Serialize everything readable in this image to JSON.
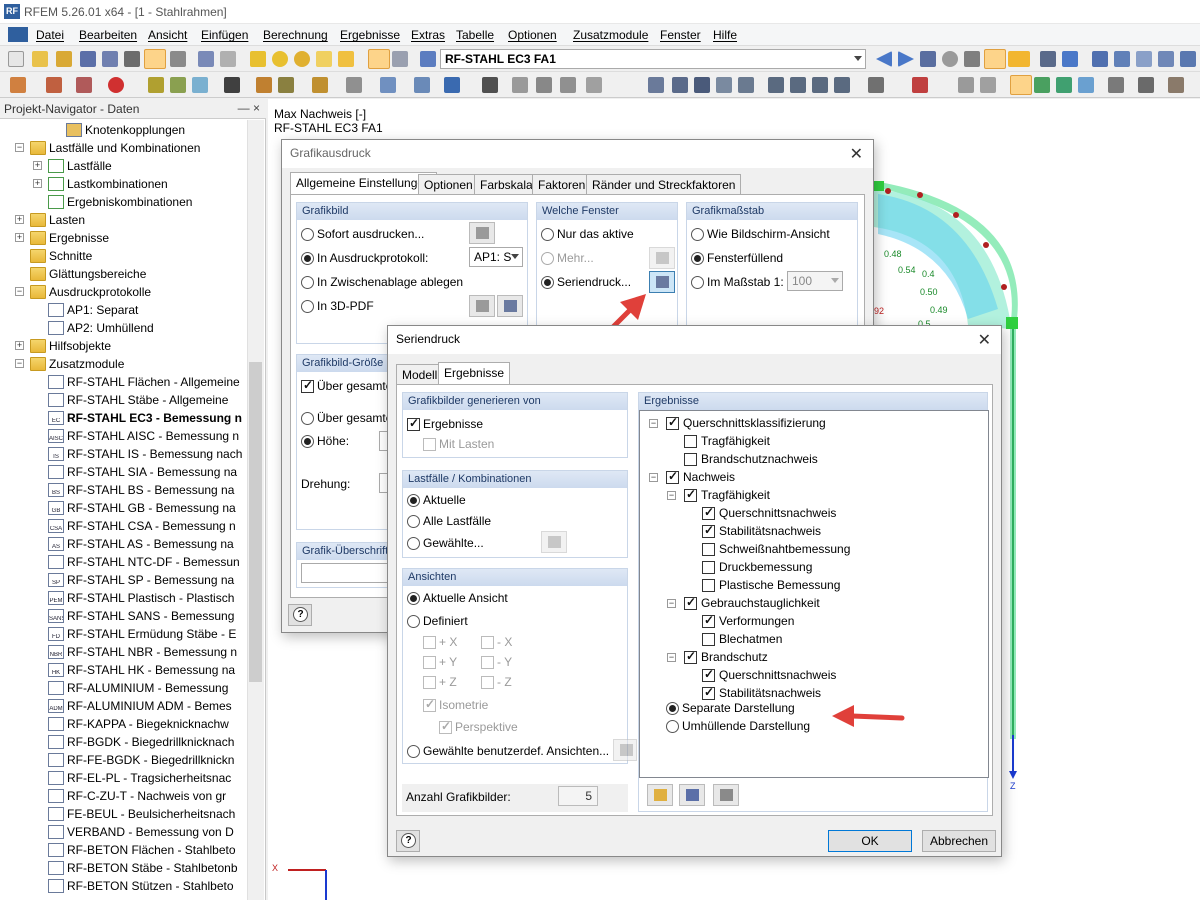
{
  "app": {
    "title": "RFEM 5.26.01 x64 - [1 - Stahlrahmen]",
    "logo": "RF"
  },
  "menu": [
    "Datei",
    "Bearbeiten",
    "Ansicht",
    "Einfügen",
    "Berechnung",
    "Ergebnisse",
    "Extras",
    "Tabelle",
    "Optionen",
    "Zusatzmodule",
    "Fenster",
    "Hilfe"
  ],
  "toolbar": {
    "case_combo": "RF-STAHL EC3 FA1"
  },
  "navigator": {
    "title": "Projekt-Navigator - Daten",
    "pin": "―  ×",
    "items": [
      {
        "label": "Knotenkopplungen"
      },
      {
        "label": "Lastfälle und Kombinationen"
      },
      {
        "label": "Lastfälle"
      },
      {
        "label": "Lastkombinationen"
      },
      {
        "label": "Ergebniskombinationen"
      },
      {
        "label": "Lasten"
      },
      {
        "label": "Ergebnisse"
      },
      {
        "label": "Schnitte"
      },
      {
        "label": "Glättungsbereiche"
      },
      {
        "label": "Ausdruckprotokolle"
      },
      {
        "label": "AP1: Separat"
      },
      {
        "label": "AP2: Umhüllend"
      },
      {
        "label": "Hilfsobjekte"
      },
      {
        "label": "Zusatzmodule"
      },
      {
        "label": "RF-STAHL Flächen - Allgemeine"
      },
      {
        "label": "RF-STAHL Stäbe - Allgemeine"
      },
      {
        "label": "RF-STAHL EC3 - Bemessung n"
      },
      {
        "label": "RF-STAHL AISC - Bemessung n"
      },
      {
        "label": "RF-STAHL IS - Bemessung nach"
      },
      {
        "label": "RF-STAHL SIA - Bemessung na"
      },
      {
        "label": "RF-STAHL BS - Bemessung na"
      },
      {
        "label": "RF-STAHL GB - Bemessung na"
      },
      {
        "label": "RF-STAHL CSA - Bemessung n"
      },
      {
        "label": "RF-STAHL AS - Bemessung na"
      },
      {
        "label": "RF-STAHL NTC-DF - Bemessun"
      },
      {
        "label": "RF-STAHL SP - Bemessung na"
      },
      {
        "label": "RF-STAHL Plastisch - Plastisch"
      },
      {
        "label": "RF-STAHL SANS - Bemessung"
      },
      {
        "label": "RF-STAHL Ermüdung Stäbe - E"
      },
      {
        "label": "RF-STAHL NBR - Bemessung n"
      },
      {
        "label": "RF-STAHL HK - Bemessung na"
      },
      {
        "label": "RF-ALUMINIUM - Bemessung"
      },
      {
        "label": "RF-ALUMINIUM ADM - Bemes"
      },
      {
        "label": "RF-KAPPA - Biegeknicknachw"
      },
      {
        "label": "RF-BGDK - Biegedrillknicknach"
      },
      {
        "label": "RF-FE-BGDK - Biegedrillknickn"
      },
      {
        "label": "RF-EL-PL - Tragsicherheitsnac"
      },
      {
        "label": "RF-C-ZU-T - Nachweis von gr"
      },
      {
        "label": "FE-BEUL - Beulsicherheitsnach"
      },
      {
        "label": "VERBAND - Bemessung von D"
      },
      {
        "label": "RF-BETON Flächen - Stahlbeto"
      },
      {
        "label": "RF-BETON Stäbe - Stahlbetonb"
      },
      {
        "label": "RF-BETON Stützen - Stahlbeto"
      }
    ],
    "icon_tags": [
      "",
      "",
      "",
      "",
      "",
      "",
      "",
      "",
      "",
      "",
      "",
      "",
      "",
      "",
      "",
      "",
      "EC",
      "AISC",
      "IS",
      "",
      "BS",
      "GB",
      "CSA",
      "AS",
      "",
      "SP",
      "PEM",
      "SANS",
      "FD",
      "NBR",
      "HK",
      "",
      "ADM",
      "",
      "",
      "",
      "",
      "",
      "",
      "",
      "",
      "",
      ""
    ]
  },
  "workspace": {
    "line1": "Max Nachweis [-]",
    "line2": "RF-STAHL EC3 FA1",
    "values": [
      "0.48",
      "0.54",
      "0.4",
      "0.50",
      "0.49",
      "0.5",
      "92"
    ],
    "axis_x": "X",
    "axis_z": "Z"
  },
  "grafikausdruck": {
    "title": "Grafikausdruck",
    "tabs": [
      "Allgemeine Einstellungen",
      "Optionen",
      "Farbskala",
      "Faktoren",
      "Ränder und Streckfaktoren"
    ],
    "grafikbild": {
      "header": "Grafikbild",
      "opt1": "Sofort ausdrucken...",
      "opt2": "In Ausdruckprotokoll:",
      "opt2_combo": "AP1: S",
      "opt3": "In Zwischenablage ablegen",
      "opt4": "In 3D-PDF"
    },
    "fenster": {
      "header": "Welche Fenster",
      "opt1": "Nur das aktive",
      "opt2": "Mehr...",
      "opt3": "Seriendruck..."
    },
    "massstab": {
      "header": "Grafikmaßstab",
      "opt1": "Wie Bildschirm-Ansicht",
      "opt2": "Fensterfüllend",
      "opt3": "Im Maßstab 1:",
      "scale": "100"
    },
    "groesse": {
      "header": "Grafikbild-Größe u",
      "opt1": "Über gesamte S",
      "opt2": "Über gesamte S",
      "opt3": "Höhe:",
      "drehung": "Drehung:"
    },
    "ueberschrift": {
      "header": "Grafik-Überschrift"
    }
  },
  "seriendruck": {
    "title": "Seriendruck",
    "tabs": [
      "Modell",
      "Ergebnisse"
    ],
    "generieren": {
      "header": "Grafikbilder generieren von",
      "ergebnisse": "Ergebnisse",
      "mit_lasten": "Mit Lasten"
    },
    "lastfaelle": {
      "header": "Lastfälle / Kombinationen",
      "opt1": "Aktuelle",
      "opt2": "Alle Lastfälle",
      "opt3": "Gewählte..."
    },
    "ansichten": {
      "header": "Ansichten",
      "opt1": "Aktuelle Ansicht",
      "opt2": "Definiert",
      "px": "+ X",
      "mx": "- X",
      "py": "+ Y",
      "my": "- Y",
      "pz": "+ Z",
      "mz": "- Z",
      "iso": "Isometrie",
      "persp": "Perspektive",
      "opt3": "Gewählte benutzerdef. Ansichten..."
    },
    "anzahl_label": "Anzahl Grafikbilder:",
    "anzahl_value": "5",
    "ergebnisse": {
      "header": "Ergebnisse",
      "tree": [
        {
          "label": "Querschnittsklassifizierung"
        },
        {
          "label": "Tragfähigkeit"
        },
        {
          "label": "Brandschutznachweis"
        },
        {
          "label": "Nachweis"
        },
        {
          "label": "Tragfähigkeit"
        },
        {
          "label": "Querschnittsnachweis"
        },
        {
          "label": "Stabilitätsnachweis"
        },
        {
          "label": "Schweißnahtbemessung"
        },
        {
          "label": "Druckbemessung"
        },
        {
          "label": "Plastische Bemessung"
        },
        {
          "label": "Gebrauchstauglichkeit"
        },
        {
          "label": "Verformungen"
        },
        {
          "label": "Blechatmen"
        },
        {
          "label": "Brandschutz"
        },
        {
          "label": "Querschnittsnachweis"
        },
        {
          "label": "Stabilitätsnachweis"
        }
      ],
      "separate": "Separate Darstellung",
      "umhuellende": "Umhüllende Darstellung"
    },
    "ok": "OK",
    "abbrechen": "Abbrechen"
  },
  "colors": {
    "accent_blue": "#0078d7",
    "arrow_red": "#e0403a",
    "group_header": "#dfe8f5",
    "model_green": "#3ddc84"
  }
}
